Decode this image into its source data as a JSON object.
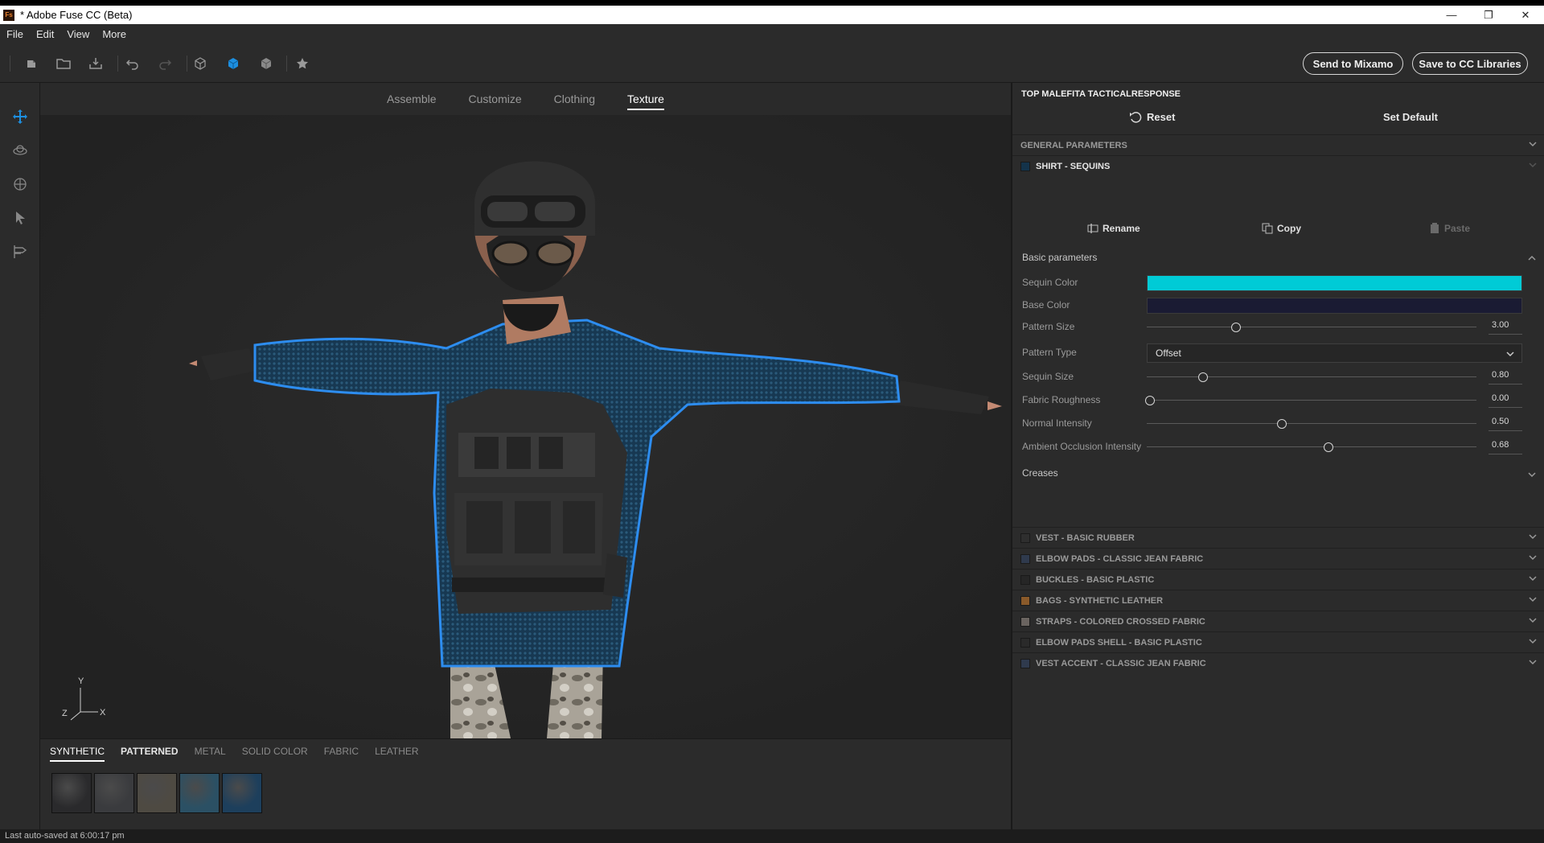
{
  "window": {
    "title": "* Adobe Fuse CC (Beta)",
    "logo_text": "Fs",
    "minimize": "—",
    "maximize": "❐",
    "close": "✕"
  },
  "menu": [
    "File",
    "Edit",
    "View",
    "More"
  ],
  "toolbar": {
    "send_label": "Send to Mixamo",
    "save_label": "Save to CC Libraries"
  },
  "tabs": [
    "Assemble",
    "Customize",
    "Clothing",
    "Texture"
  ],
  "active_tab": "Texture",
  "axis": {
    "y": "Y",
    "z": "Z",
    "x": "X"
  },
  "materials": {
    "tabs": [
      "SYNTHETIC",
      "PATTERNED",
      "METAL",
      "SOLID COLOR",
      "FABRIC",
      "LEATHER"
    ],
    "active_tab": "SYNTHETIC",
    "swatch_colors": [
      "#2a2a2c",
      "#3a3b3e",
      "#4e4a42",
      "#2b5064",
      "#1d3f5c"
    ]
  },
  "status": "Last auto-saved at 6:00:17 pm",
  "panel": {
    "title": "TOP MALEFITA TACTICALRESPONSE",
    "reset_label": "Reset",
    "set_default_label": "Set Default",
    "general_params": "GENERAL PARAMETERS",
    "current_section": {
      "label": "SHIRT - SEQUINS",
      "swatch": "#14334a"
    },
    "rename_label": "Rename",
    "copy_label": "Copy",
    "paste_label": "Paste",
    "basic_params_label": "Basic parameters",
    "sequin_color": {
      "label": "Sequin Color",
      "color": "#00cbd6"
    },
    "base_color": {
      "label": "Base Color",
      "color": "#1a1b33"
    },
    "sliders": [
      {
        "label": "Pattern Size",
        "value": "3.00",
        "fraction": 0.27
      },
      {
        "label": "Sequin Size",
        "value": "0.80",
        "fraction": 0.17
      },
      {
        "label": "Fabric Roughness",
        "value": "0.00",
        "fraction": 0.01
      },
      {
        "label": "Normal Intensity",
        "value": "0.50",
        "fraction": 0.41
      },
      {
        "label": "Ambient Occlusion Intensity",
        "value": "0.68",
        "fraction": 0.55
      }
    ],
    "pattern_type": {
      "label": "Pattern Type",
      "value": "Offset"
    },
    "creases_label": "Creases",
    "other_sections": [
      {
        "label": "VEST - BASIC RUBBER",
        "swatch": "#2e2e2e"
      },
      {
        "label": "ELBOW PADS - CLASSIC JEAN FABRIC",
        "swatch": "#2f3a4d"
      },
      {
        "label": "BUCKLES - BASIC PLASTIC",
        "swatch": "#262626"
      },
      {
        "label": "BAGS - SYNTHETIC LEATHER",
        "swatch": "#8a5a2a"
      },
      {
        "label": "STRAPS - COLORED CROSSED FABRIC",
        "swatch": "#6a6460"
      },
      {
        "label": "ELBOW PADS SHELL - BASIC PLASTIC",
        "swatch": "#2a2a2a"
      },
      {
        "label": "VEST ACCENT - CLASSIC JEAN FABRIC",
        "swatch": "#2f3a4d"
      }
    ]
  }
}
